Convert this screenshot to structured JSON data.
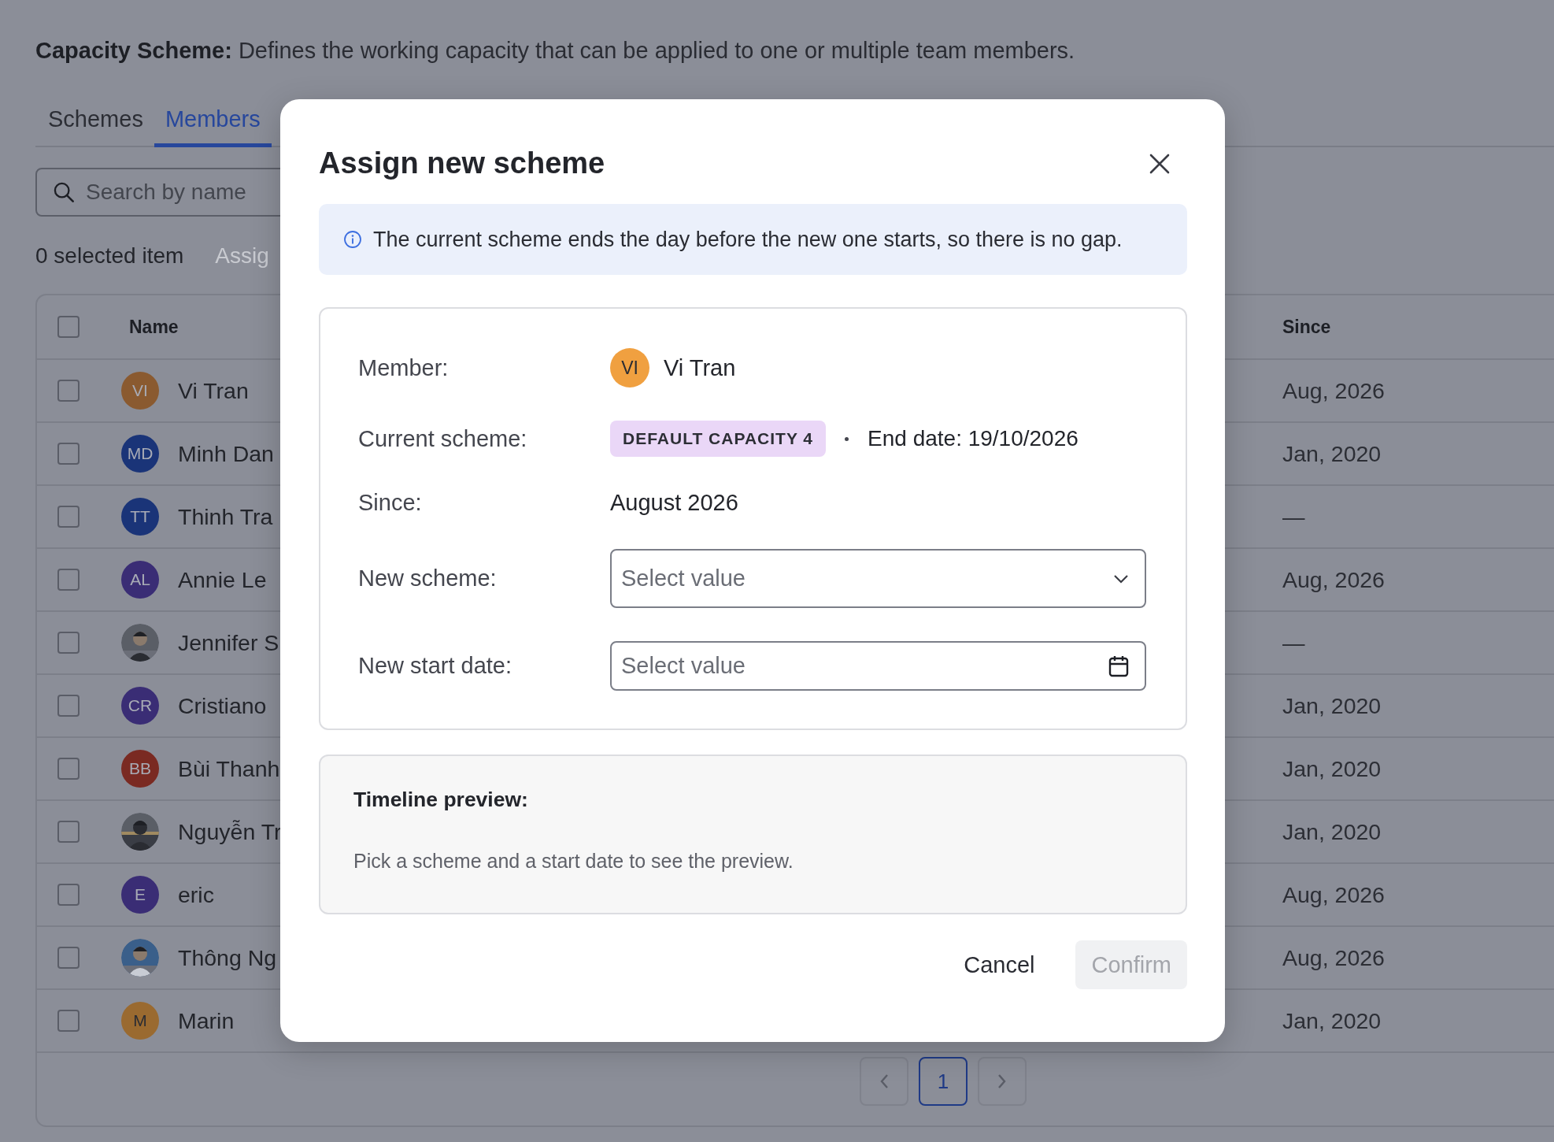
{
  "header": {
    "description": "**Capacity Scheme:** Defines the working capacity that can be applied to one or multiple team members."
  },
  "tabs": [
    {
      "label": "Schemes",
      "selected": false
    },
    {
      "label": "Members",
      "selected": true
    }
  ],
  "search": {
    "placeholder": "Search by name"
  },
  "selection": {
    "count_label": "0 selected item",
    "action": {
      "label": "Assig",
      "disabled": true
    }
  },
  "table": {
    "header_checked": false,
    "columns": [
      {
        "label": "Name"
      },
      {
        "label": "Since"
      }
    ],
    "rows": [
      {
        "name": "Vi Tran",
        "avatar": {
          "kind": "initials",
          "initials": "VI",
          "color": "#8a5a30"
        },
        "since": "Aug, 2026",
        "checked": false
      },
      {
        "name": "Minh Dan",
        "avatar": {
          "kind": "initials",
          "initials": "MD",
          "color": "#1a3478"
        },
        "since": "Jan, 2020",
        "checked": false
      },
      {
        "name": "Thinh Tra",
        "avatar": {
          "kind": "initials",
          "initials": "TT",
          "color": "#1a3478"
        },
        "since": "—",
        "checked": false
      },
      {
        "name": "Annie Le",
        "avatar": {
          "kind": "initials",
          "initials": "AL",
          "color": "#3a2d75"
        },
        "since": "Aug, 2026",
        "checked": false
      },
      {
        "name": "Jennifer S",
        "since": "—",
        "checked": false
      },
      {
        "name": "Cristiano",
        "avatar": {
          "kind": "initials",
          "initials": "CR",
          "color": "#3a2d75"
        },
        "since": "Jan, 2020",
        "checked": false
      },
      {
        "name": "Bùi Thanh",
        "avatar": {
          "kind": "initials",
          "initials": "BB",
          "color": "#7a2a22"
        },
        "since": "Jan, 2020",
        "checked": false
      },
      {
        "name": "Nguyễn Tr",
        "since": "Jan, 2020",
        "checked": false
      },
      {
        "name": "eric",
        "avatar": {
          "kind": "initials",
          "initials": "E",
          "color": "#3a2d75"
        },
        "since": "Aug, 2026",
        "checked": false
      },
      {
        "name": "Thông Ng",
        "since": "Aug, 2026",
        "checked": false
      },
      {
        "name": "Marin",
        "avatar": {
          "kind": "initials",
          "initials": "M",
          "color": "#9a6a30"
        },
        "since": "Jan, 2020",
        "checked": false
      }
    ]
  },
  "pagination": {
    "pages": [
      {
        "label": "1",
        "selected": true
      }
    ]
  },
  "modal": {
    "title": "Assign new scheme",
    "info": "The current scheme ends the day before the new one starts, so there is no gap.",
    "member": {
      "label": "Member:",
      "initials": "VI",
      "color": "#f0a040",
      "name": "Vi Tran"
    },
    "current_scheme": {
      "label": "Current scheme:",
      "badge": "DEFAULT CAPACITY 4",
      "end_date": "End date: 19/10/2026"
    },
    "since": {
      "label": "Since:",
      "value": "August 2026"
    },
    "new_scheme": {
      "label": "New scheme:",
      "placeholder": "Select value"
    },
    "new_start_date": {
      "label": "New start date:",
      "placeholder": "Select value"
    },
    "timeline": {
      "title": "Timeline preview:",
      "text": "Pick a scheme and a start date to see the preview."
    },
    "buttons": [
      {
        "label": "Cancel",
        "kind": "text",
        "disabled": false
      },
      {
        "label": "Confirm",
        "kind": "primary",
        "disabled": true
      }
    ]
  }
}
